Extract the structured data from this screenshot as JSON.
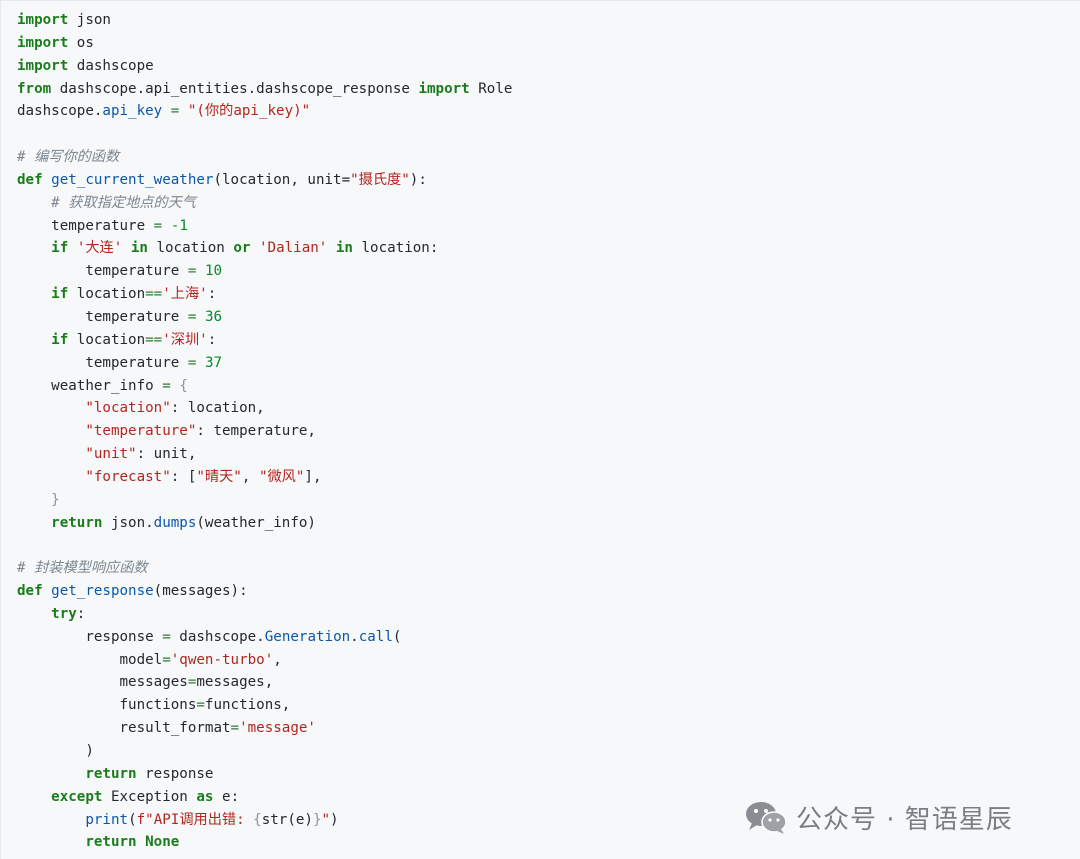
{
  "code_lines": [
    [
      [
        "kw",
        "import"
      ],
      [
        "t",
        " json"
      ]
    ],
    [
      [
        "kw",
        "import"
      ],
      [
        "t",
        " os"
      ]
    ],
    [
      [
        "kw",
        "import"
      ],
      [
        "t",
        " dashscope"
      ]
    ],
    [
      [
        "kw",
        "from"
      ],
      [
        "t",
        " dashscope.api_entities.dashscope_response "
      ],
      [
        "kw",
        "import"
      ],
      [
        "t",
        " Role"
      ]
    ],
    [
      [
        "t",
        "dashscope."
      ],
      [
        "fn",
        "api_key"
      ],
      [
        "t",
        " "
      ],
      [
        "op",
        "="
      ],
      [
        "t",
        " "
      ],
      [
        "str",
        "\"(你的api_key)\""
      ]
    ],
    [],
    [
      [
        "cmt",
        "# 编写你的函数"
      ]
    ],
    [
      [
        "kw",
        "def"
      ],
      [
        "t",
        " "
      ],
      [
        "fn",
        "get_current_weather"
      ],
      [
        "t",
        "(location, unit="
      ],
      [
        "str",
        "\"摄氏度\""
      ],
      [
        "t",
        "):"
      ]
    ],
    [
      [
        "t",
        "    "
      ],
      [
        "cmt",
        "# 获取指定地点的天气"
      ]
    ],
    [
      [
        "t",
        "    temperature "
      ],
      [
        "op",
        "="
      ],
      [
        "t",
        " "
      ],
      [
        "op",
        "-"
      ],
      [
        "num",
        "1"
      ]
    ],
    [
      [
        "t",
        "    "
      ],
      [
        "kw",
        "if"
      ],
      [
        "t",
        " "
      ],
      [
        "str",
        "'大连'"
      ],
      [
        "t",
        " "
      ],
      [
        "kw",
        "in"
      ],
      [
        "t",
        " location "
      ],
      [
        "kw",
        "or"
      ],
      [
        "t",
        " "
      ],
      [
        "str",
        "'Dalian'"
      ],
      [
        "t",
        " "
      ],
      [
        "kw",
        "in"
      ],
      [
        "t",
        " location:"
      ]
    ],
    [
      [
        "t",
        "        temperature "
      ],
      [
        "op",
        "="
      ],
      [
        "t",
        " "
      ],
      [
        "num",
        "10"
      ]
    ],
    [
      [
        "t",
        "    "
      ],
      [
        "kw",
        "if"
      ],
      [
        "t",
        " location"
      ],
      [
        "op",
        "=="
      ],
      [
        "str",
        "'上海'"
      ],
      [
        "t",
        ":"
      ]
    ],
    [
      [
        "t",
        "        temperature "
      ],
      [
        "op",
        "="
      ],
      [
        "t",
        " "
      ],
      [
        "num",
        "36"
      ]
    ],
    [
      [
        "t",
        "    "
      ],
      [
        "kw",
        "if"
      ],
      [
        "t",
        " location"
      ],
      [
        "op",
        "=="
      ],
      [
        "str",
        "'深圳'"
      ],
      [
        "t",
        ":"
      ]
    ],
    [
      [
        "t",
        "        temperature "
      ],
      [
        "op",
        "="
      ],
      [
        "t",
        " "
      ],
      [
        "num",
        "37"
      ]
    ],
    [
      [
        "t",
        "    weather_info "
      ],
      [
        "op",
        "="
      ],
      [
        "t",
        " "
      ],
      [
        "brk",
        "{"
      ]
    ],
    [
      [
        "t",
        "        "
      ],
      [
        "str",
        "\"location\""
      ],
      [
        "t",
        ": location,"
      ]
    ],
    [
      [
        "t",
        "        "
      ],
      [
        "str",
        "\"temperature\""
      ],
      [
        "t",
        ": temperature,"
      ]
    ],
    [
      [
        "t",
        "        "
      ],
      [
        "str",
        "\"unit\""
      ],
      [
        "t",
        ": unit,"
      ]
    ],
    [
      [
        "t",
        "        "
      ],
      [
        "str",
        "\"forecast\""
      ],
      [
        "t",
        ": ["
      ],
      [
        "str",
        "\"晴天\""
      ],
      [
        "t",
        ", "
      ],
      [
        "str",
        "\"微风\""
      ],
      [
        "t",
        "],"
      ]
    ],
    [
      [
        "t",
        "    "
      ],
      [
        "brk",
        "}"
      ]
    ],
    [
      [
        "t",
        "    "
      ],
      [
        "kw",
        "return"
      ],
      [
        "t",
        " json."
      ],
      [
        "fn",
        "dumps"
      ],
      [
        "t",
        "(weather_info)"
      ]
    ],
    [],
    [
      [
        "cmt",
        "# 封装模型响应函数"
      ]
    ],
    [
      [
        "kw",
        "def"
      ],
      [
        "t",
        " "
      ],
      [
        "fn",
        "get_response"
      ],
      [
        "t",
        "(messages):"
      ]
    ],
    [
      [
        "t",
        "    "
      ],
      [
        "kw",
        "try"
      ],
      [
        "t",
        ":"
      ]
    ],
    [
      [
        "t",
        "        response "
      ],
      [
        "op",
        "="
      ],
      [
        "t",
        " dashscope."
      ],
      [
        "fn",
        "Generation"
      ],
      [
        "t",
        "."
      ],
      [
        "fn",
        "call"
      ],
      [
        "t",
        "("
      ]
    ],
    [
      [
        "t",
        "            model"
      ],
      [
        "op",
        "="
      ],
      [
        "str",
        "'qwen-turbo'"
      ],
      [
        "t",
        ","
      ]
    ],
    [
      [
        "t",
        "            messages"
      ],
      [
        "op",
        "="
      ],
      [
        "t",
        "messages,"
      ]
    ],
    [
      [
        "t",
        "            functions"
      ],
      [
        "op",
        "="
      ],
      [
        "t",
        "functions,"
      ]
    ],
    [
      [
        "t",
        "            result_format"
      ],
      [
        "op",
        "="
      ],
      [
        "str",
        "'message'"
      ]
    ],
    [
      [
        "t",
        "        )"
      ]
    ],
    [
      [
        "t",
        "        "
      ],
      [
        "kw",
        "return"
      ],
      [
        "t",
        " response"
      ]
    ],
    [
      [
        "t",
        "    "
      ],
      [
        "kw",
        "except"
      ],
      [
        "t",
        " Exception "
      ],
      [
        "kw",
        "as"
      ],
      [
        "t",
        " e:"
      ]
    ],
    [
      [
        "t",
        "        "
      ],
      [
        "fn",
        "print"
      ],
      [
        "t",
        "("
      ],
      [
        "str",
        "f\"API调用出错: "
      ],
      [
        "brk",
        "{"
      ],
      [
        "t",
        "str(e)"
      ],
      [
        "brk",
        "}"
      ],
      [
        "str",
        "\""
      ],
      [
        "t",
        ")"
      ]
    ],
    [
      [
        "t",
        "        "
      ],
      [
        "kw",
        "return"
      ],
      [
        "t",
        " "
      ],
      [
        "kw",
        "None"
      ]
    ]
  ],
  "watermark": {
    "text": "公众号 · 智语星辰",
    "icon": "wechat-icon"
  },
  "colors": {
    "background": "#f6f8fa",
    "keyword": "#1a7c1a",
    "function": "#0b57a8",
    "string": "#b3261e",
    "number": "#0a8a2a",
    "comment": "#7d8790",
    "text": "#24292e"
  }
}
